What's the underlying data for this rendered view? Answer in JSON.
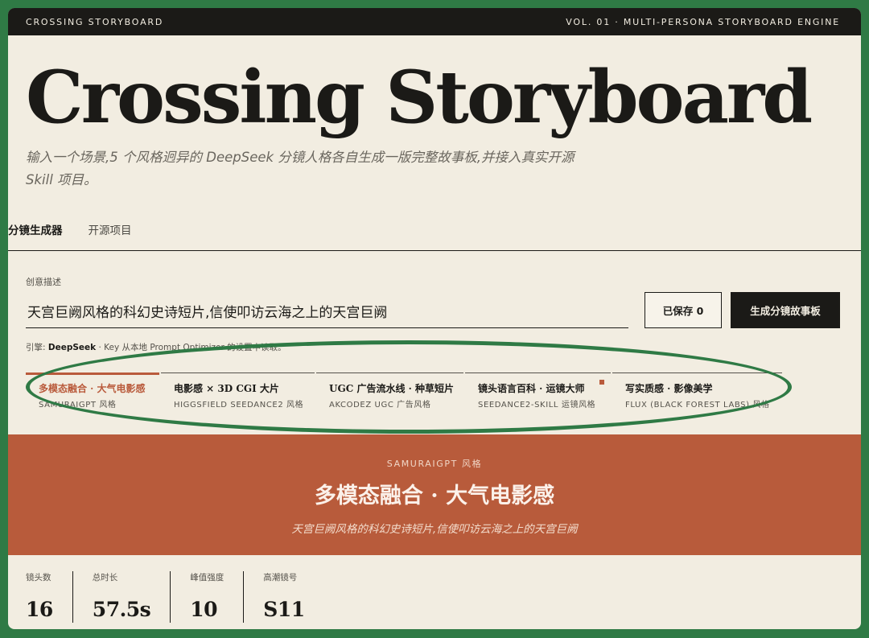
{
  "topbar": {
    "brand": "CROSSING STORYBOARD",
    "edition": "VOL. 01 · MULTI-PERSONA STORYBOARD ENGINE"
  },
  "hero": {
    "title": "Crossing Storyboard",
    "subtitle": "输入一个场景,5 个风格迥异的 DeepSeek 分镜人格各自生成一版完整故事板,并接入真实开源 Skill 项目。"
  },
  "tabs": [
    {
      "label": "分镜生成器",
      "active": true
    },
    {
      "label": "开源项目",
      "active": false
    }
  ],
  "form": {
    "label": "创意描述",
    "prompt_value": "天宫巨阙风格的科幻史诗短片,信使叩访云海之上的天宫巨阙",
    "saved_label": "已保存 0",
    "generate_label": "生成分镜故事板",
    "engine_prefix": "引擎:",
    "engine_name": "DeepSeek",
    "engine_note": "· Key 从本地 Prompt Optimizer 的设置中读取。"
  },
  "styles": [
    {
      "title": "多模态融合 · 大气电影感",
      "source": "SAMURAIGPT 风格",
      "active": true
    },
    {
      "title": "电影感 × 3D CGI 大片",
      "source": "HIGGSFIELD SEEDANCE2 风格",
      "active": false
    },
    {
      "title": "UGC 广告流水线 · 种草短片",
      "source": "AKCODEZ UGC 广告风格",
      "active": false
    },
    {
      "title": "镜头语言百科 · 运镜大师",
      "source": "SEEDANCE2-SKILL 运镜风格",
      "active": false,
      "marker": true
    },
    {
      "title": "写实质感 · 影像美学",
      "source": "FLUX (BLACK FOREST LABS) 风格",
      "active": false
    }
  ],
  "banner": {
    "kicker": "SAMURAIGPT 风格",
    "headline": "多模态融合 · 大气电影感",
    "summary": "天宫巨阙风格的科幻史诗短片,信使叩访云海之上的天宫巨阙"
  },
  "stats": [
    {
      "label": "镜头数",
      "value": "16"
    },
    {
      "label": "总时长",
      "value": "57.5s"
    },
    {
      "label": "峰值强度",
      "value": "10"
    },
    {
      "label": "高潮镜号",
      "value": "S11"
    }
  ],
  "colors": {
    "accent": "#b85b3b",
    "paper": "#f2ede1",
    "ink": "#1b1a17",
    "frame": "#2f7a45"
  }
}
